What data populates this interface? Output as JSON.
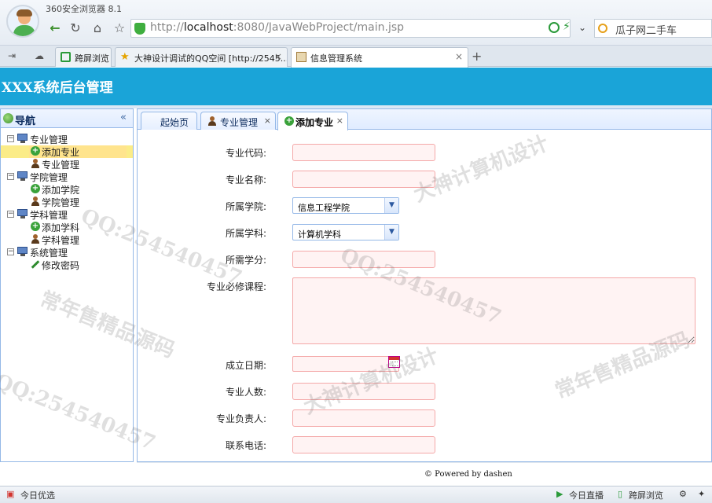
{
  "browser": {
    "title": "360安全浏览器 8.1",
    "url_prefix": "http://",
    "url_host": "localhost",
    "url_rest": ":8080/JavaWebProject/main.jsp",
    "search_text": "瓜子网二手车",
    "tabs": [
      {
        "label": "跨屏浏览"
      },
      {
        "label": "大神设计调试的QQ空间 [http://2545..."
      },
      {
        "label": "信息管理系统"
      }
    ],
    "new_tab": "+"
  },
  "app": {
    "title": "XXX系统后台管理"
  },
  "sidebar": {
    "title": "导航",
    "collapse": "«",
    "groups": [
      {
        "label": "专业管理",
        "children": [
          {
            "label": "添加专业"
          },
          {
            "label": "专业管理"
          }
        ]
      },
      {
        "label": "学院管理",
        "children": [
          {
            "label": "添加学院"
          },
          {
            "label": "学院管理"
          }
        ]
      },
      {
        "label": "学科管理",
        "children": [
          {
            "label": "添加学科"
          },
          {
            "label": "学科管理"
          }
        ]
      },
      {
        "label": "系统管理",
        "children": [
          {
            "label": "修改密码"
          }
        ]
      }
    ]
  },
  "content_tabs": [
    {
      "label": "起始页"
    },
    {
      "label": "专业管理"
    },
    {
      "label": "添加专业"
    }
  ],
  "form": {
    "code_label": "专业代码:",
    "name_label": "专业名称:",
    "college_label": "所属学院:",
    "college_value": "信息工程学院",
    "subject_label": "所属学科:",
    "subject_value": "计算机学科",
    "credit_label": "所需学分:",
    "courses_label": "专业必修课程:",
    "date_label": "成立日期:",
    "count_label": "专业人数:",
    "leader_label": "专业负责人:",
    "phone_label": "联系电话:"
  },
  "footer": {
    "text": "© Powered by dashen"
  },
  "statusbar": {
    "left": "今日优选",
    "live": "今日直播",
    "cross": "跨屏浏览"
  },
  "watermarks": [
    "大神计算机设计",
    "常年售精品源码",
    "QQ:254540457"
  ],
  "colors": {
    "header": "#1aa4d8",
    "panel_border": "#95b8e7",
    "selected": "#ffe48d",
    "required_field": "#fff3f3"
  }
}
